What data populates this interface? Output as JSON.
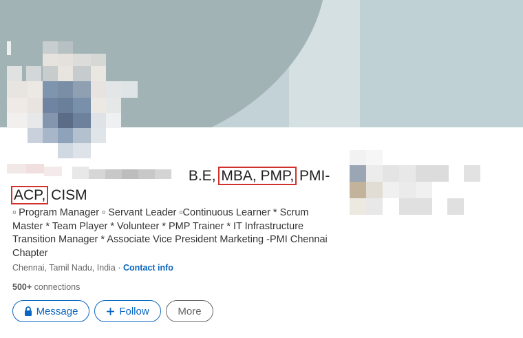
{
  "profile": {
    "name_suffix": "B.E,",
    "credential_boxed_1": "MBA, PMP,",
    "credential_after_1": "PMI-",
    "credential_boxed_2": "ACP,",
    "credential_after_2": "CISM",
    "headline": "▫ Program Manager ▫ Servant Leader ▫Continuous Learner * Scrum Master * Team Player * Volunteer * PMP Trainer * IT Infrastructure Transition Manager * Associate Vice President Marketing -PMI Chennai Chapter",
    "location": "Chennai, Tamil Nadu, India ·",
    "contact_link": "Contact info",
    "connections_count": "500+",
    "connections_label": "connections"
  },
  "actions": {
    "message_label": "Message",
    "follow_label": "Follow",
    "more_label": "More"
  },
  "colors": {
    "accent": "#0a66c2",
    "highlight_box": "#d0312d",
    "banner": "#a2b3b6"
  },
  "icons": {
    "message": "lock-icon",
    "follow": "plus-icon"
  }
}
